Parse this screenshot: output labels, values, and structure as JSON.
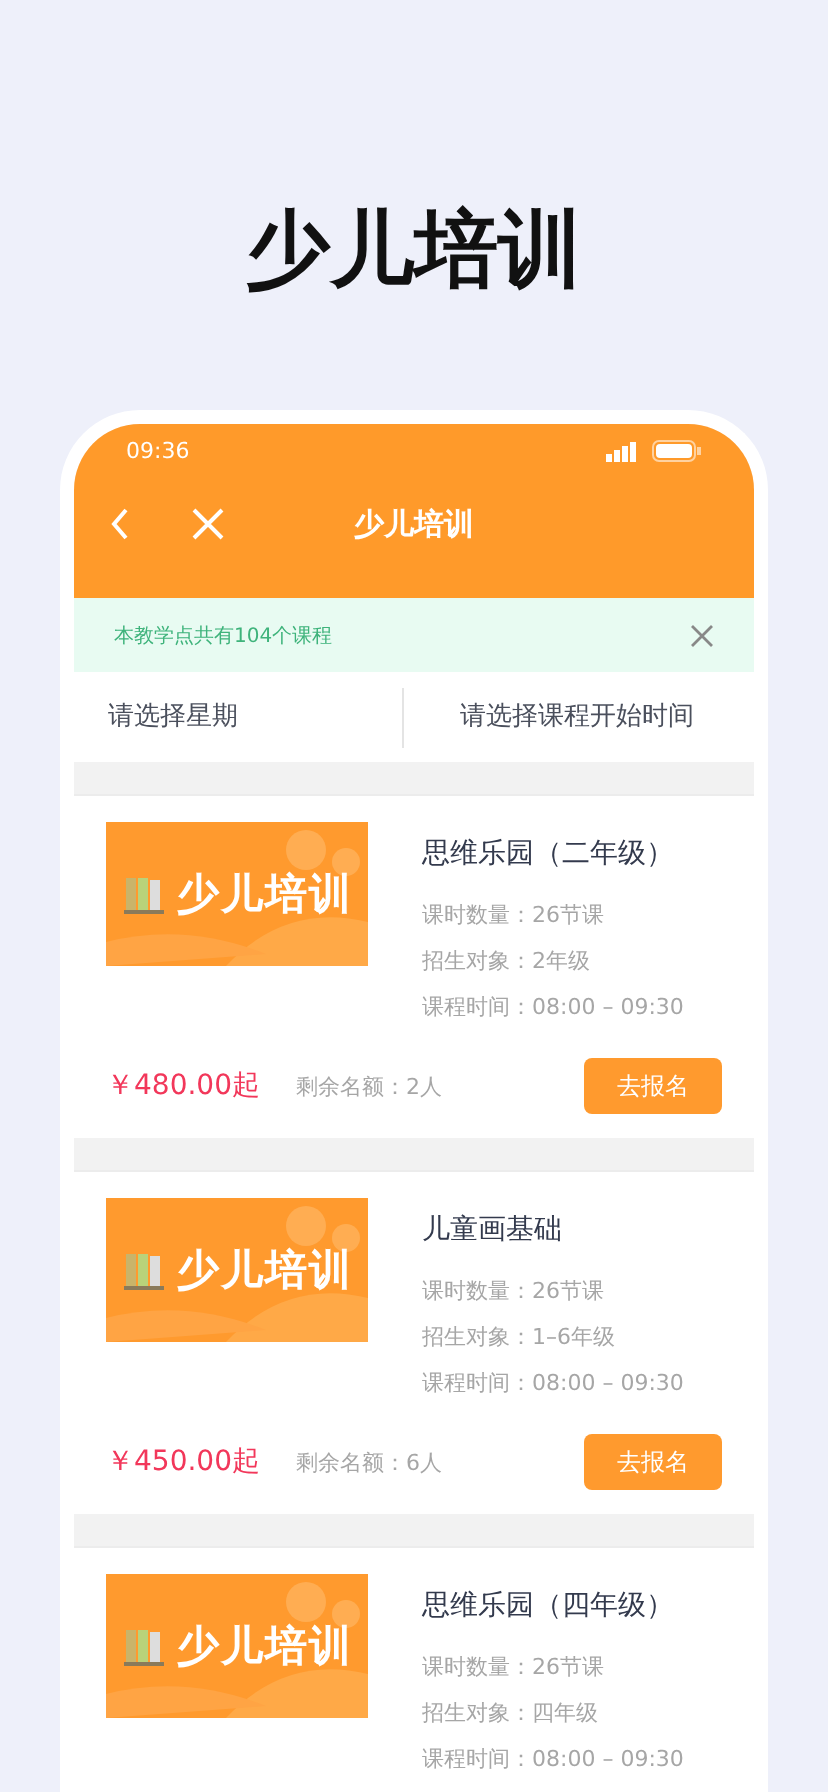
{
  "headline": "少儿培训",
  "status_bar": {
    "time": "09:36"
  },
  "nav": {
    "title": "少儿培训"
  },
  "notice": {
    "text": "本教学点共有104个课程"
  },
  "filters": [
    "请选择星期",
    "请选择课程开始时间"
  ],
  "courses": [
    {
      "banner_text": "少儿培训",
      "title": "思维乐园（二年级）",
      "hours": "课时数量：26节课",
      "target": "招生对象：2年级",
      "time": "课程时间：08:00 – 09:30",
      "price": "￥480.00起",
      "remaining": "剩余名额：2人",
      "button": "去报名"
    },
    {
      "banner_text": "少儿培训",
      "title": "儿童画基础",
      "hours": "课时数量：26节课",
      "target": "招生对象：1–6年级",
      "time": "课程时间：08:00 – 09:30",
      "price": "￥450.00起",
      "remaining": "剩余名额：6人",
      "button": "去报名"
    },
    {
      "banner_text": "少儿培训",
      "title": "思维乐园（四年级）",
      "hours": "课时数量：26节课",
      "target": "招生对象：四年级",
      "time": "课程时间：08:00 – 09:30"
    }
  ]
}
